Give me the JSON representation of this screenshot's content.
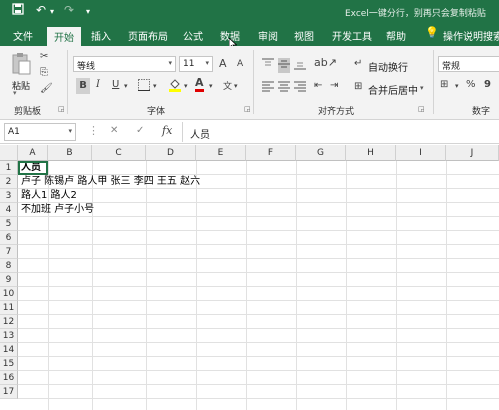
{
  "titlebar": {
    "save_icon": "save-icon",
    "undo_icon": "undo-icon",
    "redo_icon": "redo-icon",
    "customize_icon": "customize-icon",
    "title": "Excel一键分行，别再只会复制粘贴"
  },
  "tabs": [
    "文件",
    "开始",
    "插入",
    "页面布局",
    "公式",
    "数据",
    "审阅",
    "视图",
    "开发工具",
    "帮助"
  ],
  "active_tab": "开始",
  "tell_me": "操作说明搜索",
  "ribbon": {
    "clipboard": {
      "paste": "粘贴",
      "label": "剪贴板"
    },
    "font": {
      "name": "等线",
      "size": "11",
      "bold": "B",
      "italic": "I",
      "underline": "U",
      "grow": "A",
      "shrink": "A",
      "font_color": "A",
      "label": "字体"
    },
    "alignment": {
      "wrap": "自动换行",
      "merge": "合并后居中",
      "label": "对齐方式"
    },
    "number": {
      "format": "常规",
      "percent": "%",
      "comma": "9",
      "label": "数字"
    }
  },
  "formula_bar": {
    "namebox": "A1",
    "cancel": "✕",
    "enter": "✓",
    "fx": "fx",
    "content": "人员"
  },
  "columns": [
    "A",
    "B",
    "C",
    "D",
    "E",
    "F",
    "G",
    "H",
    "I",
    "J"
  ],
  "rows": [
    "1",
    "2",
    "3",
    "4",
    "5",
    "6",
    "7",
    "8",
    "9",
    "10",
    "11",
    "12",
    "13",
    "14",
    "15",
    "16",
    "17"
  ],
  "cells": {
    "a1": "人员",
    "a2": "卢子 陈锡卢 路人甲 张三 李四 王五 赵六",
    "a3": "路人1 路人2",
    "a4": "不加班 卢子小号"
  }
}
